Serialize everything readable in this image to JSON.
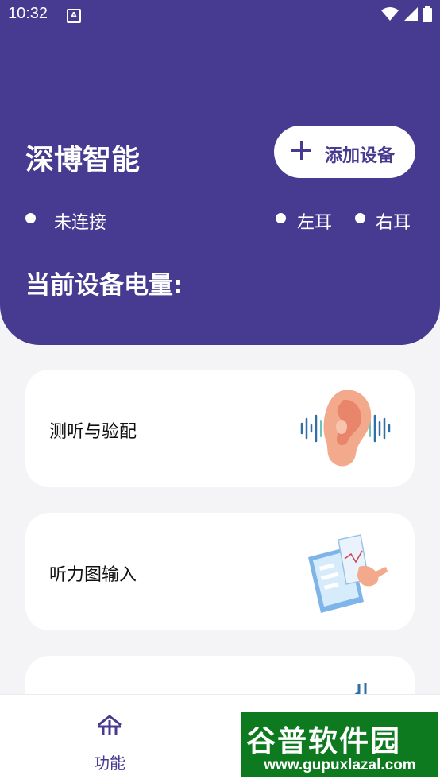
{
  "status_bar": {
    "time": "10:32",
    "notification_icon": "A",
    "icons": [
      "wifi-icon",
      "signal-icon",
      "battery-icon"
    ]
  },
  "header": {
    "title": "深博智能",
    "add_device_label": "添加设备",
    "connection_status": "未连接",
    "left_ear": "左耳",
    "right_ear": "右耳",
    "battery_title": "当前设备电量:"
  },
  "cards": [
    {
      "label": "测听与验配",
      "icon": "ear-sound-icon"
    },
    {
      "label": "听力图输入",
      "icon": "audiogram-tablet-icon"
    },
    {
      "label": "",
      "icon": "music-note-icon"
    }
  ],
  "bottom_nav": {
    "items": [
      {
        "label": "功能",
        "icon": "home-icon"
      }
    ]
  },
  "watermark": {
    "main": "谷普软件园",
    "sub": "www.gupuxlazal.com"
  },
  "colors": {
    "primary": "#463a91",
    "background": "#f4f4f6",
    "card": "#ffffff"
  }
}
